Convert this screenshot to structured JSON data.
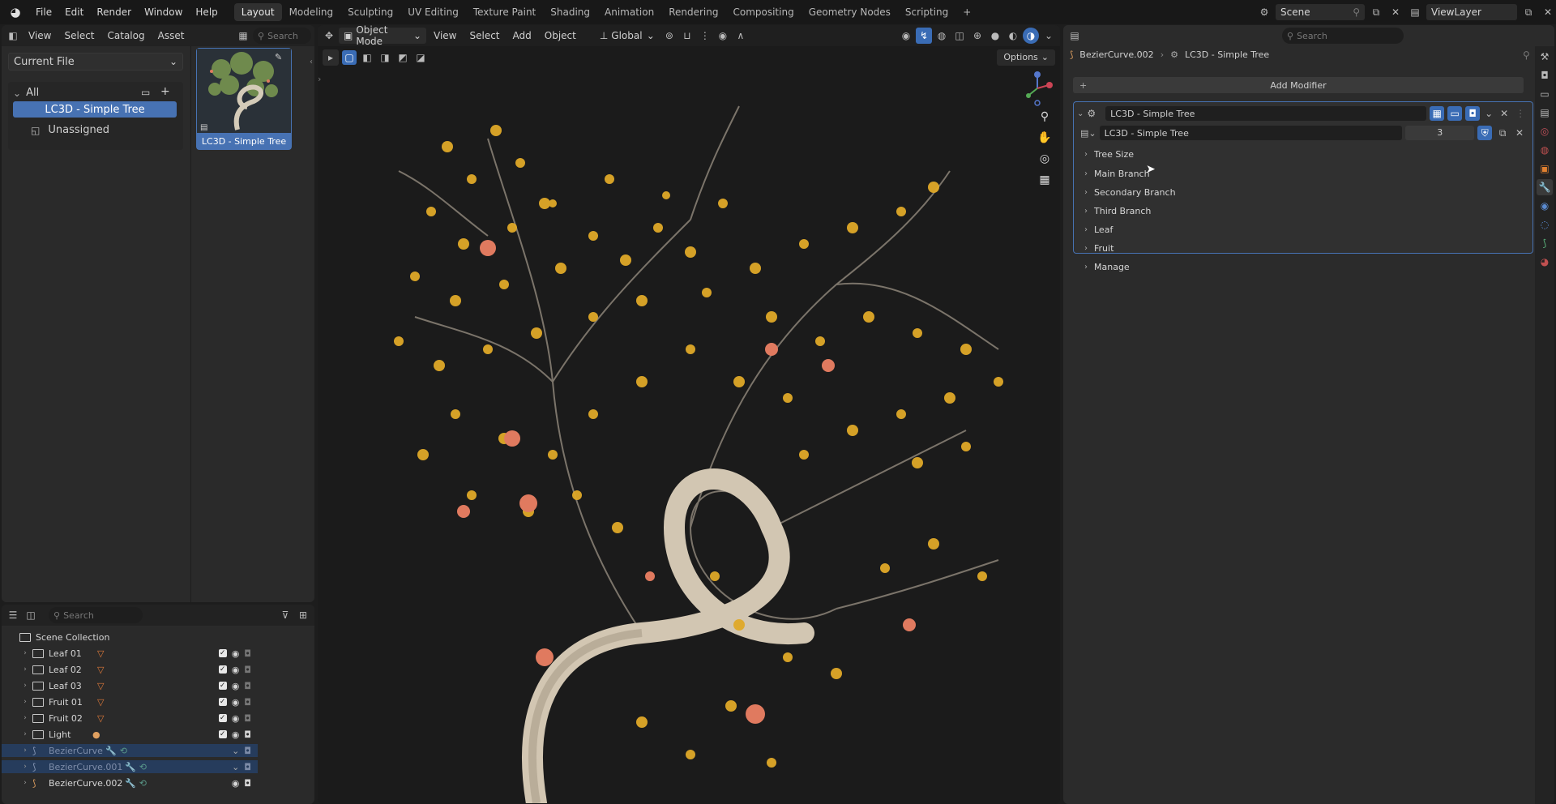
{
  "menu": [
    "File",
    "Edit",
    "Render",
    "Window",
    "Help"
  ],
  "workspaces": [
    {
      "label": "Layout",
      "active": true
    },
    {
      "label": "Modeling"
    },
    {
      "label": "Sculpting"
    },
    {
      "label": "UV Editing"
    },
    {
      "label": "Texture Paint"
    },
    {
      "label": "Shading"
    },
    {
      "label": "Animation"
    },
    {
      "label": "Rendering"
    },
    {
      "label": "Compositing"
    },
    {
      "label": "Geometry Nodes"
    },
    {
      "label": "Scripting"
    }
  ],
  "topright": {
    "scene": "Scene",
    "view_layer": "ViewLayer"
  },
  "asset_browser": {
    "header": [
      "View",
      "Select",
      "Catalog",
      "Asset"
    ],
    "search_placeholder": "Search",
    "library": "Current File",
    "tree_root": "All",
    "catalog_selected": "LC3D - Simple Tree",
    "catalog_unassigned": "Unassigned",
    "asset_name": "LC3D - Simple Tree"
  },
  "viewport": {
    "mode": "Object Mode",
    "header": [
      "View",
      "Select",
      "Add",
      "Object"
    ],
    "orientation": "Global",
    "options": "Options"
  },
  "outliner": {
    "search_placeholder": "Search",
    "root": "Scene Collection",
    "rows": [
      {
        "name": "Leaf 01"
      },
      {
        "name": "Leaf 02"
      },
      {
        "name": "Leaf 03"
      },
      {
        "name": "Fruit 01"
      },
      {
        "name": "Fruit 02"
      },
      {
        "name": "Light"
      },
      {
        "name": "BezierCurve"
      },
      {
        "name": "BezierCurve.001"
      },
      {
        "name": "BezierCurve.002"
      }
    ]
  },
  "properties": {
    "search_placeholder": "Search",
    "breadcrumb_object": "BezierCurve.002",
    "breadcrumb_modifier": "LC3D - Simple Tree",
    "add_modifier": "Add Modifier",
    "modifier_name": "LC3D - Simple Tree",
    "node_group": "LC3D - Simple Tree",
    "user_count": "3",
    "panels": [
      "Tree Size",
      "Main Branch",
      "Secondary Branch",
      "Third Branch",
      "Leaf",
      "Fruit",
      "Manage"
    ]
  },
  "colors": {
    "accent": "#4772b3",
    "selection": "#263c5c",
    "leaf": "#e0a928",
    "fruit": "#e07a5f",
    "bark": "#c9bca8"
  }
}
